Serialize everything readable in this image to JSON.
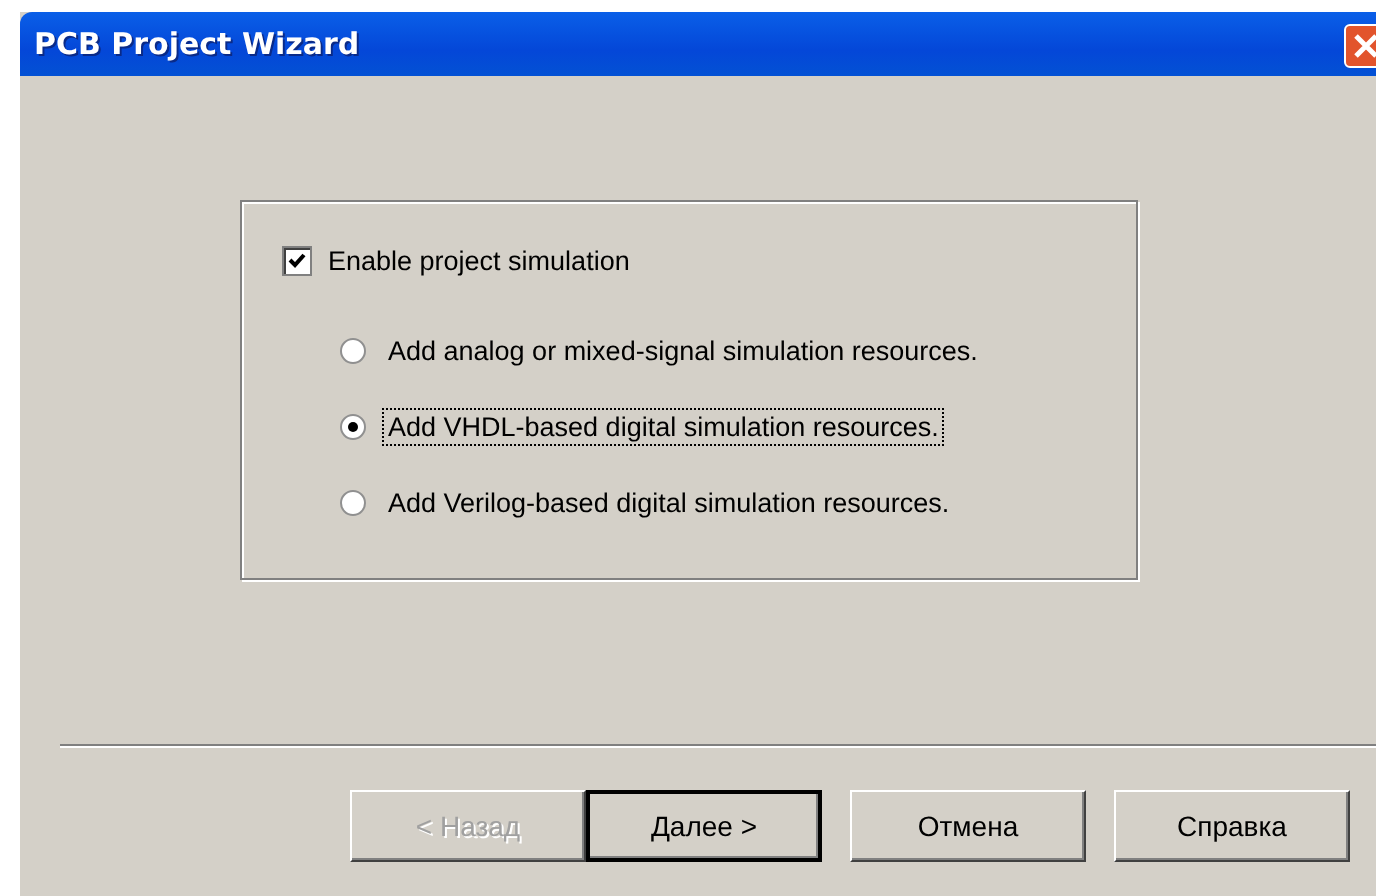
{
  "window": {
    "title": "PCB Project Wizard"
  },
  "enable_simulation": {
    "label": "Enable project simulation",
    "checked": true
  },
  "options": [
    {
      "label": "Add analog or mixed-signal simulation resources.",
      "selected": false
    },
    {
      "label": "Add VHDL-based digital simulation resources.",
      "selected": true
    },
    {
      "label": "Add Verilog-based digital simulation resources.",
      "selected": false
    }
  ],
  "buttons": [
    {
      "label": "< Назад",
      "disabled": true,
      "default": false
    },
    {
      "label": "Далее >",
      "disabled": false,
      "default": true
    },
    {
      "label": "Отмена",
      "disabled": false,
      "default": false
    },
    {
      "label": "Справка",
      "disabled": false,
      "default": false
    }
  ]
}
